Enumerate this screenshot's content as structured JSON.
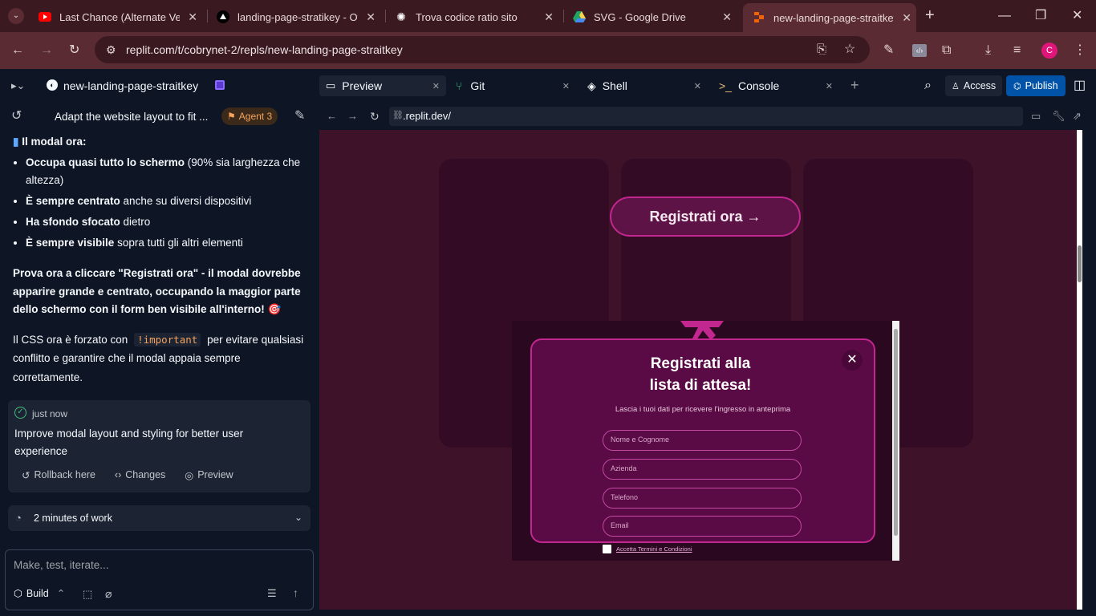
{
  "browser": {
    "tabs": [
      {
        "title": "Last Chance (Alternate Versic",
        "icon": "youtube-icon"
      },
      {
        "title": "landing-page-stratikey - Ove",
        "icon": "vercel-icon"
      },
      {
        "title": "Trova codice ratio sito",
        "icon": "openai-icon"
      },
      {
        "title": "SVG - Google Drive",
        "icon": "google-drive-icon"
      },
      {
        "title": "new-landing-page-straitkey",
        "icon": "replit-icon"
      }
    ],
    "url": "replit.com/t/cobrynet-2/repls/new-landing-page-straitkey",
    "profile_initial": "C"
  },
  "replit": {
    "project_name": "new-landing-page-straitkey",
    "chat_title": "Adapt the website layout to fit ...",
    "agent_badge": "Agent 3",
    "pane_tabs": [
      "Preview",
      "Git",
      "Shell",
      "Console"
    ],
    "access_label": "Access",
    "publish_label": "Publish"
  },
  "chat": {
    "heading": "Il modal ora:",
    "bullets": [
      {
        "bold": "Occupa quasi tutto lo schermo",
        "rest": " (90% sia larghezza che altezza)"
      },
      {
        "bold": "È sempre centrato",
        "rest": " anche su diversi dispositivi"
      },
      {
        "bold": "Ha sfondo sfocato",
        "rest": " dietro"
      },
      {
        "bold": "È sempre visibile",
        "rest": " sopra tutti gli altri elementi"
      }
    ],
    "paragraph_bold": "Prova ora a cliccare \"Registrati ora\" - il modal dovrebbe apparire grande e centrato, occupando la maggior parte dello schermo con il form ben visibile all'interno! 🎯",
    "css_pre": "Il CSS ora è forzato con ",
    "css_code": "!important",
    "css_post": " per evitare qualsiasi conflitto e garantire che il modal appaia sempre correttamente.",
    "checkpoint_time": "just now",
    "checkpoint_text": "Improve modal layout and styling for better user experience",
    "rollback_label": "Rollback here",
    "changes_label": "Changes",
    "preview_label": "Preview",
    "work_label": "2 minutes of work",
    "input_placeholder": "Make, test, iterate...",
    "build_label": "Build"
  },
  "preview": {
    "url": ".replit.dev/",
    "cta": "Registrati ora →",
    "modal_title_1": "Registrati alla",
    "modal_title_2": "lista di attesa!",
    "modal_subtitle": "Lascia i tuoi dati per ricevere l'ingresso in anteprima",
    "fields": [
      "Nome e Cognome",
      "Azienda",
      "Telefono",
      "Email"
    ],
    "terms": "Accetta Termini e Condizioni"
  },
  "colors": {
    "accent": "#0053a6",
    "magenta": "#c2268f",
    "modal_bg": "#5a0a45"
  }
}
